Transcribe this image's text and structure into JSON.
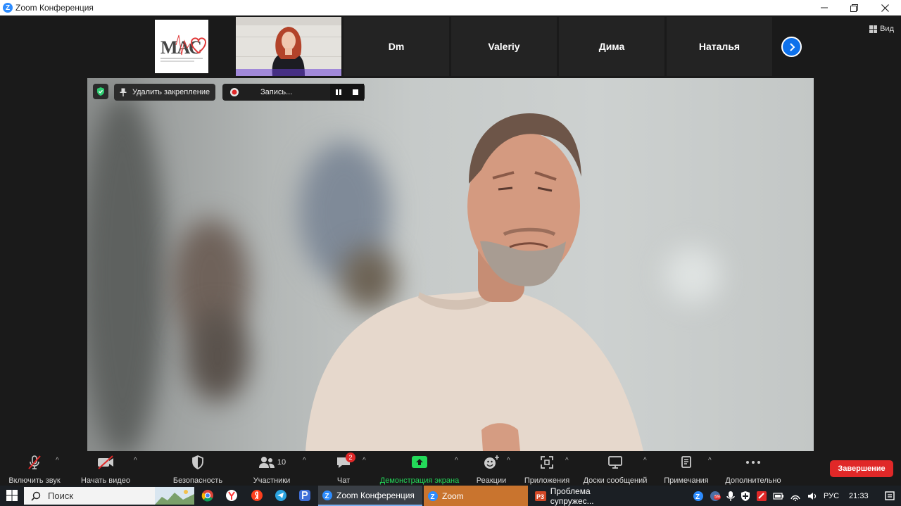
{
  "window": {
    "title": "Zoom Конференция",
    "app_icon": "zoom-logo-icon",
    "controls": [
      "minimize-icon",
      "restore-icon",
      "close-icon"
    ]
  },
  "gallery": {
    "view_label": "Вид",
    "participants": [
      "Dm",
      "Valeriy",
      "Дима",
      "Наталья"
    ],
    "next_icon": "chevron-right-icon",
    "logo_text": "МАС"
  },
  "main_video": {
    "unpin_label": "Удалить закрепление",
    "recording_label": "Запись...",
    "colors": {
      "overlay_bg": "#1f1f1f",
      "shield": "#2ecc71",
      "rec": "#e02828"
    }
  },
  "toolbar": {
    "items": [
      {
        "label": "Включить звук",
        "icon": "mic-off-icon"
      },
      {
        "label": "Начать видео",
        "icon": "video-off-icon"
      },
      {
        "label": "Безопасность",
        "icon": "shield-icon"
      },
      {
        "label": "Участники",
        "icon": "participants-icon",
        "count": "10"
      },
      {
        "label": "Чат",
        "icon": "chat-icon",
        "badge": "2"
      },
      {
        "label": "Демонстрация экрана",
        "icon": "share-screen-icon"
      },
      {
        "label": "Реакции",
        "icon": "reactions-icon"
      },
      {
        "label": "Приложения",
        "icon": "apps-icon"
      },
      {
        "label": "Доски сообщений",
        "icon": "whiteboard-icon"
      },
      {
        "label": "Примечания",
        "icon": "notes-icon"
      },
      {
        "label": "Дополнительно",
        "icon": "more-icon"
      }
    ],
    "end_label": "Завершение",
    "colors": {
      "share": "#23d959",
      "end": "#e02828"
    }
  },
  "taskbar": {
    "search_placeholder": "Поиск",
    "windows": [
      {
        "label": "Zoom Конференция",
        "icon": "zoom-icon"
      },
      {
        "label": "Zoom",
        "icon": "zoom-icon"
      },
      {
        "label": "Проблема супружес...",
        "icon": "powerpoint-icon"
      }
    ],
    "language": "РУС",
    "time": "21:33",
    "tray_badge": "59"
  }
}
